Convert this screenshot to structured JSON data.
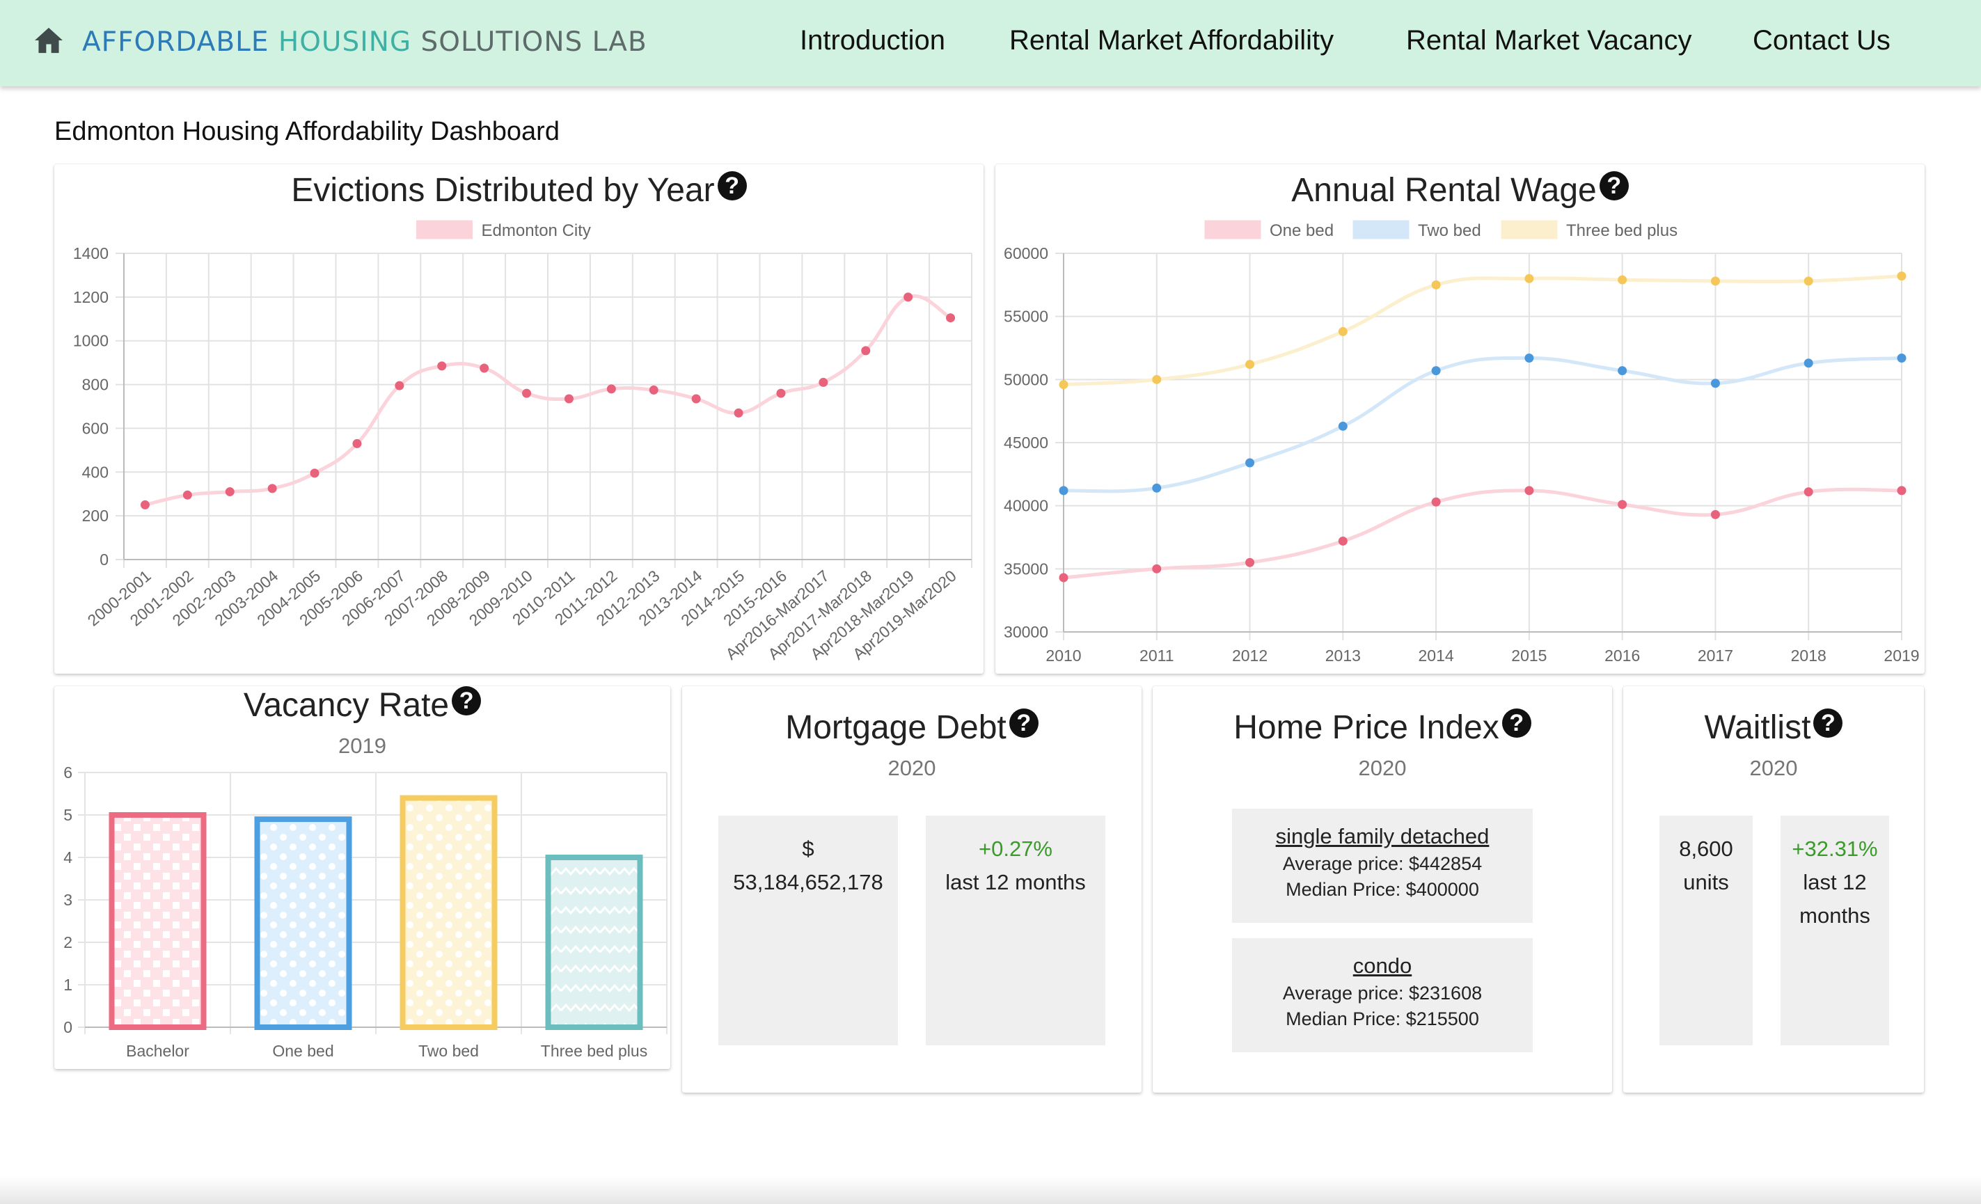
{
  "header": {
    "brand": {
      "w1": "AFFORDABLE",
      "w2": "HOUSING",
      "w3": "SOLUTIONS LAB"
    },
    "nav": [
      "Introduction",
      "Rental Market Affordability",
      "Rental Market Vacancy",
      "Contact Us"
    ],
    "brand_colors": {
      "w1": "#2c7bb6",
      "w2": "#3fb0a3",
      "w3": "#5d6b6a"
    },
    "background": "#d2f2e1",
    "home_icon": "home-icon"
  },
  "dashboard_title": "Edmonton Housing Affordability Dashboard",
  "cards": {
    "evictions": {
      "title": "Evictions Distributed by Year",
      "help": "?"
    },
    "rental_wage": {
      "title": "Annual Rental Wage",
      "help": "?"
    },
    "vacancy": {
      "title": "Vacancy Rate",
      "year": "2019",
      "help": "?"
    },
    "mortgage": {
      "title": "Mortgage Debt",
      "year": "2020",
      "help": "?",
      "amount_symbol": "$",
      "amount": "53,184,652,178",
      "change": "+0.27%",
      "period": "last 12 months"
    },
    "hpi": {
      "title": "Home Price Index",
      "year": "2020",
      "help": "?",
      "items": [
        {
          "name": "single family detached",
          "average": "Average price: $442854",
          "median": "Median Price: $400000"
        },
        {
          "name": "condo",
          "average": "Average price: $231608",
          "median": "Median Price: $215500"
        }
      ]
    },
    "waitlist": {
      "title": "Waitlist",
      "year": "2020",
      "help": "?",
      "count": "8,600",
      "unit": "units",
      "change": "+32.31%",
      "period_line1": "last 12",
      "period_line2": "months"
    }
  },
  "chart_data": [
    {
      "id": "evictions",
      "type": "line",
      "title": "Evictions Distributed by Year",
      "categories": [
        "2000-2001",
        "2001-2002",
        "2002-2003",
        "2003-2004",
        "2004-2005",
        "2005-2006",
        "2006-2007",
        "2007-2008",
        "2008-2009",
        "2009-2010",
        "2010-2011",
        "2011-2012",
        "2012-2013",
        "2013-2014",
        "2014-2015",
        "2015-2016",
        "Apr2016-Mar2017",
        "Apr2017-Mar2018",
        "Apr2018-Mar2019",
        "Apr2019-Mar2020"
      ],
      "series": [
        {
          "name": "Edmonton City",
          "color": "#e8627c",
          "fill": "#fbd3da",
          "values": [
            250,
            295,
            310,
            325,
            395,
            530,
            795,
            885,
            875,
            760,
            735,
            780,
            775,
            735,
            670,
            760,
            810,
            955,
            1200,
            1105
          ]
        }
      ],
      "ylim": [
        0,
        1400
      ],
      "yticks": [
        0,
        200,
        400,
        600,
        800,
        1000,
        1200,
        1400
      ],
      "grid": true,
      "legend": "top"
    },
    {
      "id": "rental_wage",
      "type": "line",
      "title": "Annual Rental Wage",
      "categories": [
        "2010",
        "2011",
        "2012",
        "2013",
        "2014",
        "2015",
        "2016",
        "2017",
        "2018",
        "2019"
      ],
      "series": [
        {
          "name": "One bed",
          "color": "#e8627c",
          "fill": "#fbd3da",
          "values": [
            34300,
            35000,
            35500,
            37200,
            40300,
            41200,
            40100,
            39300,
            41100,
            41200
          ]
        },
        {
          "name": "Two bed",
          "color": "#4a97dc",
          "fill": "#d3e7f8",
          "values": [
            41200,
            41400,
            43400,
            46300,
            50700,
            51700,
            50700,
            49700,
            51300,
            51700
          ]
        },
        {
          "name": "Three bed plus",
          "color": "#f5c758",
          "fill": "#fcefcd",
          "values": [
            49600,
            50000,
            51200,
            53800,
            57500,
            58000,
            57900,
            57800,
            57800,
            58200
          ]
        }
      ],
      "ylim": [
        30000,
        60000
      ],
      "yticks": [
        30000,
        35000,
        40000,
        45000,
        50000,
        55000,
        60000
      ],
      "grid": true,
      "legend": "top"
    },
    {
      "id": "vacancy",
      "type": "bar",
      "title": "Vacancy Rate",
      "subtitle": "2019",
      "categories": [
        "Bachelor",
        "One bed",
        "Two bed",
        "Three bed plus"
      ],
      "values": [
        5.0,
        4.9,
        5.4,
        4.0
      ],
      "colors": [
        "#ec6a82",
        "#4e9fe0",
        "#f6cb5f",
        "#6cbdbd"
      ],
      "fills": [
        "#fde3e8",
        "#ddeefc",
        "#fdf3d6",
        "#dff1f1"
      ],
      "patterns": [
        "square",
        "dot",
        "dot",
        "zigzag"
      ],
      "ylim": [
        0,
        6
      ],
      "yticks": [
        0,
        1,
        2,
        3,
        4,
        5,
        6
      ],
      "grid": true
    }
  ]
}
